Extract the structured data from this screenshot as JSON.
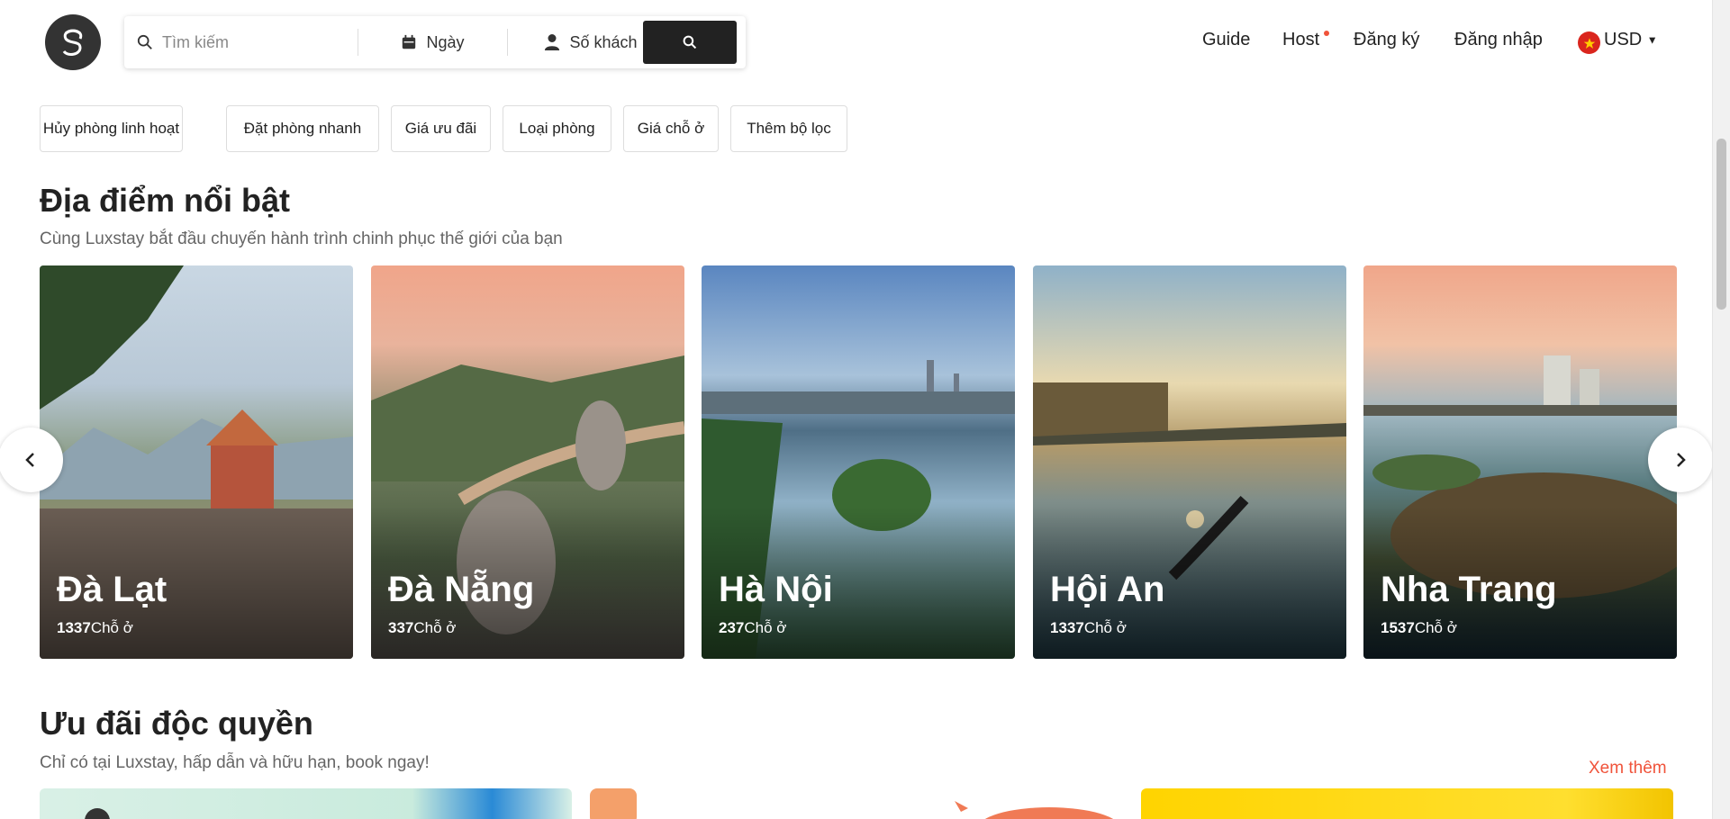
{
  "search": {
    "placeholder": "Tìm kiếm",
    "date_label": "Ngày",
    "guests_label": "Số khách"
  },
  "nav": {
    "guide": "Guide",
    "host": "Host",
    "register": "Đăng ký",
    "login": "Đăng nhập",
    "currency": "USD"
  },
  "filters": [
    "Hủy phòng linh hoạt",
    "Đặt phòng nhanh",
    "Giá ưu đãi",
    "Loại phòng",
    "Giá chỗ ở",
    "Thêm bộ lọc"
  ],
  "featured": {
    "title": "Địa điểm nổi bật",
    "subtitle": "Cùng Luxstay bắt đầu chuyến hành trình chinh phục thế giới của bạn",
    "unit": "Chỗ ở",
    "places": [
      {
        "name": "Đà Lạt",
        "count": "1337"
      },
      {
        "name": "Đà Nẵng",
        "count": "337"
      },
      {
        "name": "Hà Nội",
        "count": "237"
      },
      {
        "name": "Hội An",
        "count": "1337"
      },
      {
        "name": "Nha Trang",
        "count": "1537"
      }
    ]
  },
  "deals": {
    "title": "Ưu đãi độc quyền",
    "subtitle": "Chỉ có tại Luxstay, hấp dẫn và hữu hạn, book ngay!",
    "more": "Xem thêm"
  },
  "colors": {
    "accent": "#f0533a",
    "button": "#222222"
  },
  "icons": {
    "search": "search-icon",
    "calendar": "calendar-icon",
    "user": "user-icon",
    "flag": "vietnam-flag-icon"
  }
}
